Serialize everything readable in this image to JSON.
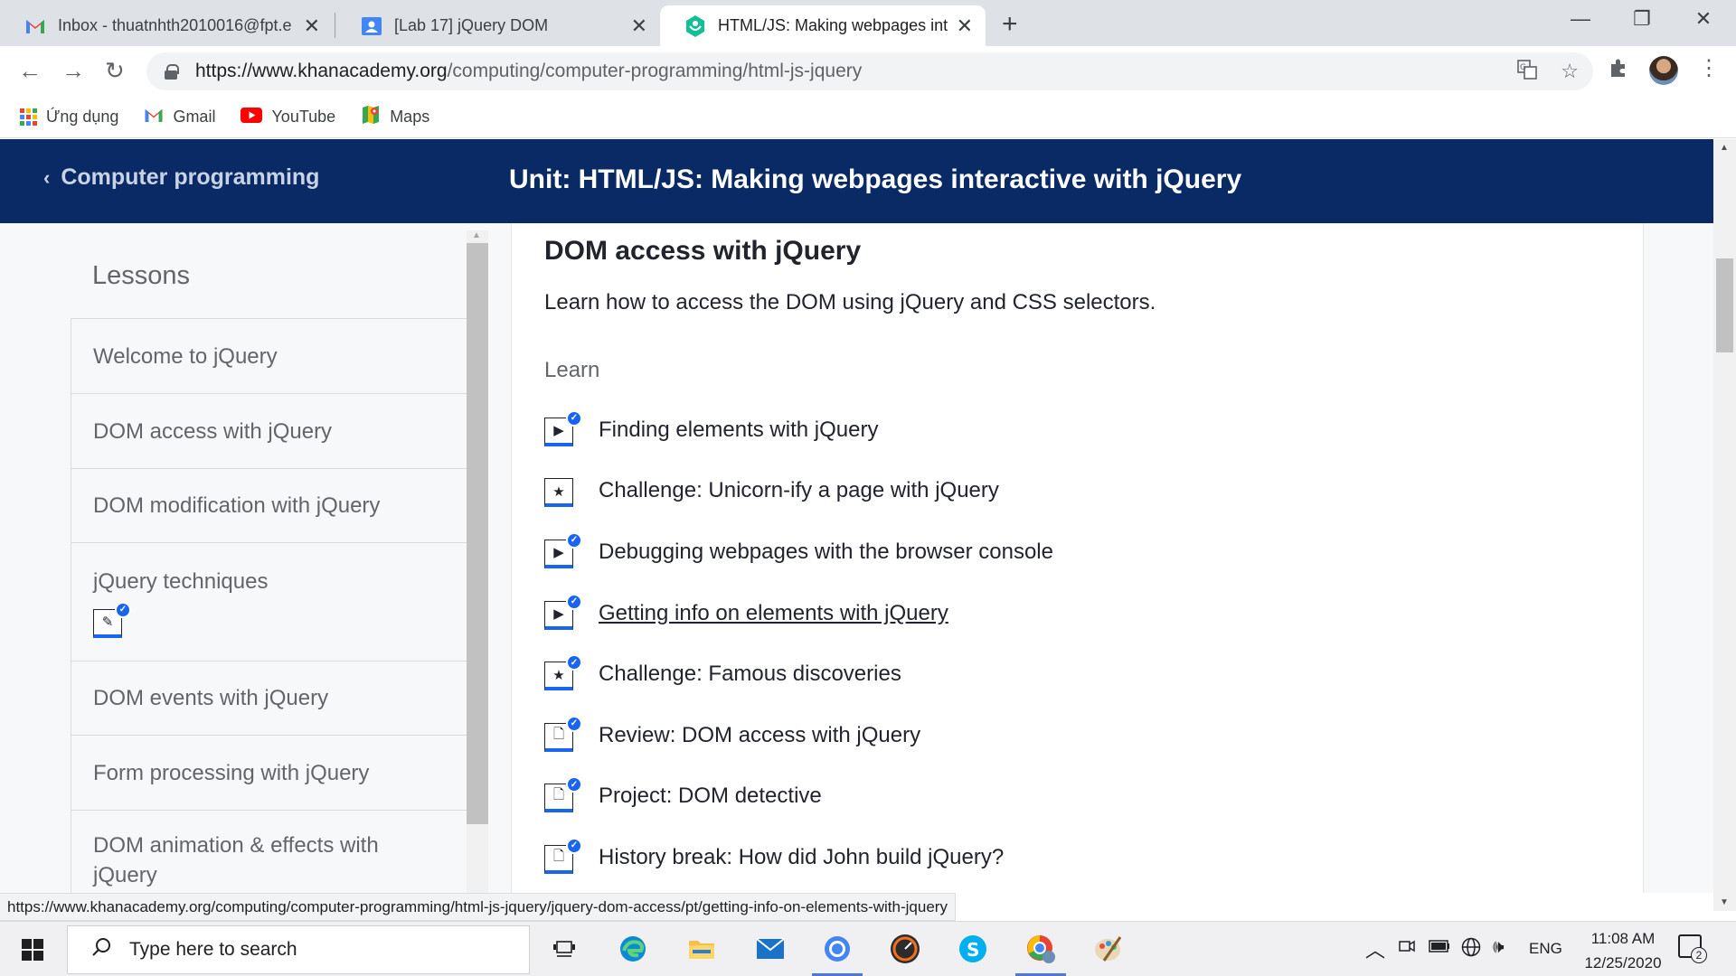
{
  "browser": {
    "tabs": [
      {
        "title": "Inbox - thuatnhth2010016@fpt.e",
        "icon": "gmail-icon",
        "active": false
      },
      {
        "title": "[Lab 17] jQuery DOM",
        "icon": "classroom-icon",
        "active": false
      },
      {
        "title": "HTML/JS: Making webpages inter",
        "icon": "khan-academy-icon",
        "active": true
      }
    ],
    "close_glyph": "✕",
    "url_host": "https://www.khanacademy.org",
    "url_path": "/computing/computer-programming/html-js-jquery",
    "bookmarks": [
      {
        "label": "Ứng dụng",
        "icon": "apps-icon"
      },
      {
        "label": "Gmail",
        "icon": "gmail-icon"
      },
      {
        "label": "YouTube",
        "icon": "youtube-icon"
      },
      {
        "label": "Maps",
        "icon": "maps-icon"
      }
    ]
  },
  "header": {
    "back_label": "Computer programming",
    "unit_title": "Unit: HTML/JS: Making webpages interactive with jQuery",
    "bg_color": "#0a2a66"
  },
  "sidebar": {
    "heading": "Lessons",
    "lessons": [
      {
        "label": "Welcome to jQuery"
      },
      {
        "label": "DOM access with jQuery"
      },
      {
        "label": "DOM modification with jQuery"
      },
      {
        "label": "jQuery techniques",
        "badge": "pencil-icon"
      },
      {
        "label": "DOM events with jQuery"
      },
      {
        "label": "Form processing with jQuery"
      },
      {
        "label": "DOM animation & effects with jQuery"
      }
    ]
  },
  "main": {
    "title": "DOM access with jQuery",
    "description": "Learn how to access the DOM using jQuery and CSS selectors.",
    "section_label": "Learn",
    "items": [
      {
        "label": "Finding elements with jQuery",
        "icon": "video-icon",
        "completed": true
      },
      {
        "label": "Challenge: Unicorn-ify a page with jQuery",
        "icon": "star-icon",
        "completed": false
      },
      {
        "label": "Debugging webpages with the browser console",
        "icon": "video-icon",
        "completed": true
      },
      {
        "label": "Getting info on elements with jQuery",
        "icon": "video-icon",
        "completed": true,
        "hovered": true
      },
      {
        "label": "Challenge: Famous discoveries",
        "icon": "star-icon",
        "completed": true
      },
      {
        "label": "Review: DOM access with jQuery",
        "icon": "article-icon",
        "completed": true
      },
      {
        "label": "Project: DOM detective",
        "icon": "article-icon",
        "completed": true
      },
      {
        "label": "History break: How did John build jQuery?",
        "icon": "article-icon",
        "completed": true
      }
    ],
    "accent_color": "#1865f2"
  },
  "status_url": "https://www.khanacademy.org/computing/computer-programming/html-js-jquery/jquery-dom-access/pt/getting-info-on-elements-with-jquery",
  "taskbar": {
    "search_placeholder": "Type here to search",
    "language": "ENG",
    "time": "11:08 AM",
    "date": "12/25/2020",
    "notification_count": "2"
  }
}
